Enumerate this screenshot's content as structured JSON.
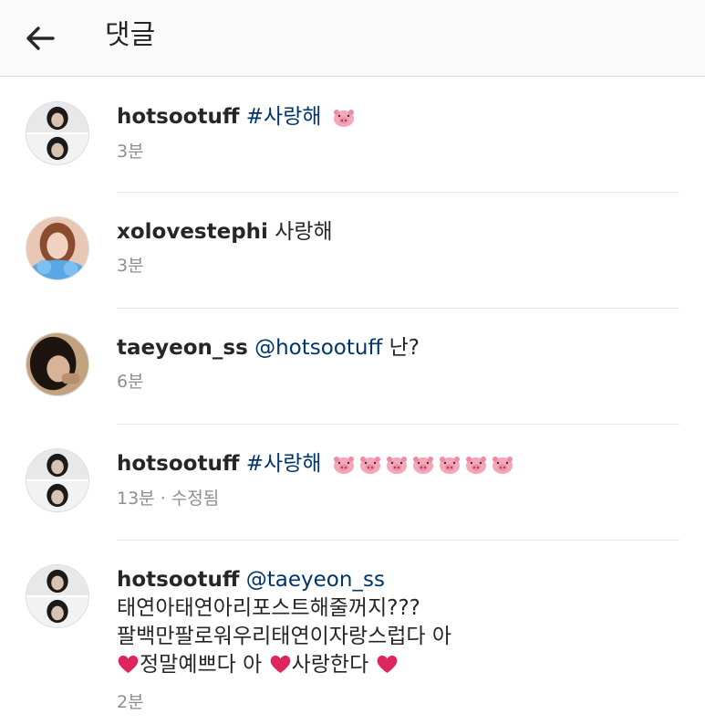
{
  "header": {
    "title": "댓글"
  },
  "comments": [
    {
      "user": "hotsootuff",
      "tag": "#사랑해",
      "text": "",
      "meta": "3분"
    },
    {
      "user": "xolovestephi",
      "tag": "",
      "text": "사랑해",
      "meta": "3분"
    },
    {
      "user": "taeyeon_ss",
      "tag": "@hotsootuff",
      "text": "난?",
      "meta": "6분"
    },
    {
      "user": "hotsootuff",
      "tag": "#사랑해",
      "text": "",
      "meta": "13분 · 수정됨"
    },
    {
      "user": "hotsootuff",
      "tag": "@taeyeon_ss",
      "line2": "태연아태연아리포스트해줄꺼지???",
      "line3": "팔백만팔로워우리태연이자랑스럽다 아",
      "line4a": "정말예쁘다 아",
      "line4b": "사랑한다",
      "meta": "2분"
    }
  ],
  "icons": {
    "back": "arrow-left-icon",
    "pig": "pig-face-emoji",
    "heart": "red-heart-emoji"
  },
  "colors": {
    "link": "#003569",
    "meta": "#8e8e8e",
    "header_bg": "#fafafa",
    "heart": "#e0245e",
    "pig": "#f4a7b9"
  }
}
